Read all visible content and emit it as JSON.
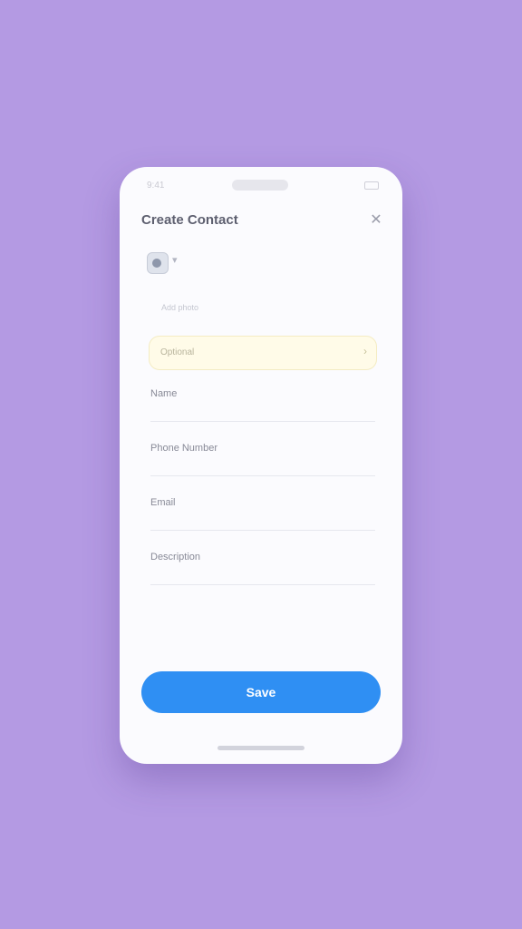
{
  "status_bar": {
    "time": "9:41"
  },
  "header": {
    "title": "Create Contact",
    "close_icon": "close-icon"
  },
  "avatar": {
    "icon": "person-icon",
    "chevron_icon": "chevron-down-icon"
  },
  "hint": {
    "text": "Add photo"
  },
  "notice": {
    "label": "Optional",
    "chevron_icon": "chevron-right-icon"
  },
  "fields": [
    {
      "label": "Name",
      "value": "",
      "placeholder": ""
    },
    {
      "label": "Phone Number",
      "value": "",
      "placeholder": ""
    },
    {
      "label": "Email",
      "value": "",
      "placeholder": ""
    },
    {
      "label": "Description",
      "value": "",
      "placeholder": ""
    }
  ],
  "submit": {
    "label": "Save"
  },
  "colors": {
    "background": "#b49ae3",
    "card": "#fbfbfe",
    "accent": "#2f8ff3",
    "notice_bg": "#fffbe8"
  }
}
